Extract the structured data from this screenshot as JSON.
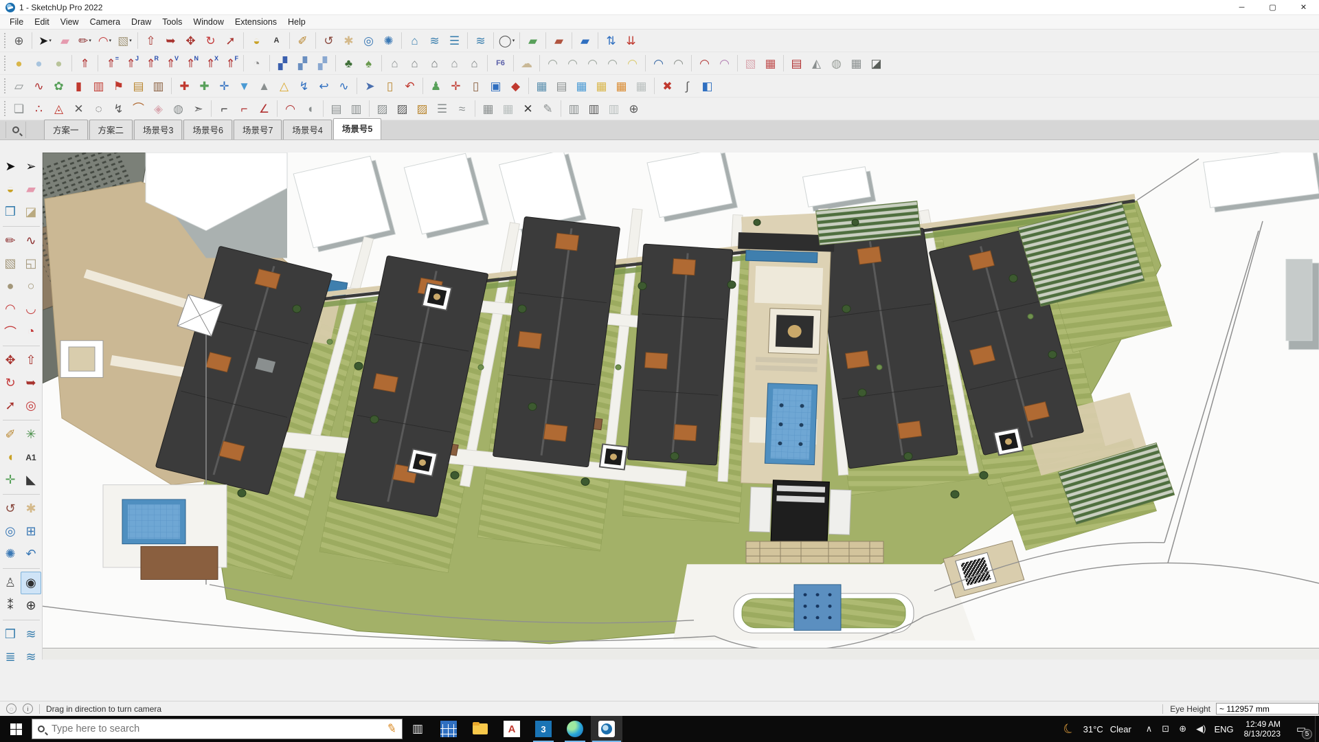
{
  "window": {
    "title": "1 - SketchUp Pro 2022",
    "minimize": "─",
    "maximize": "▢",
    "close": "✕"
  },
  "menu": {
    "items": [
      "File",
      "Edit",
      "View",
      "Camera",
      "Draw",
      "Tools",
      "Window",
      "Extensions",
      "Help"
    ]
  },
  "toolbars": {
    "rows": [
      [
        {
          "n": "zoom-tool",
          "g": "⊕",
          "c": "#5a5a5a"
        },
        {
          "sep": true
        },
        {
          "n": "select",
          "g": "➤",
          "c": "#1a1a1a",
          "dd": true
        },
        {
          "n": "eraser",
          "g": "▰",
          "c": "#e59aae"
        },
        {
          "n": "line",
          "g": "✏",
          "c": "#8c2f2f",
          "dd": true
        },
        {
          "n": "arc",
          "g": "◠",
          "c": "#c43b3b",
          "dd": true
        },
        {
          "n": "rectangle",
          "g": "▧",
          "c": "#a3977a",
          "dd": true
        },
        {
          "sep": true
        },
        {
          "n": "push-pull",
          "g": "⇧",
          "c": "#a8342f"
        },
        {
          "n": "follow-me",
          "g": "➥",
          "c": "#a8342f"
        },
        {
          "n": "move",
          "g": "✥",
          "c": "#a8342f"
        },
        {
          "n": "rotate",
          "g": "↻",
          "c": "#c43b3b"
        },
        {
          "n": "scale",
          "g": "➚",
          "c": "#a8342f"
        },
        {
          "sep": true
        },
        {
          "n": "paint-bucket",
          "g": "◒",
          "c": "#c9a227"
        },
        {
          "n": "text",
          "g": "A",
          "c": "#3a3a3a",
          "txt": true
        },
        {
          "sep": true
        },
        {
          "n": "tape-measure",
          "g": "✐",
          "c": "#b9862f"
        },
        {
          "sep": true
        },
        {
          "n": "orbit",
          "g": "↺",
          "c": "#8a4a3f"
        },
        {
          "n": "pan",
          "g": "✱",
          "c": "#d4b98a"
        },
        {
          "n": "zoom",
          "g": "◎",
          "c": "#3a78b5"
        },
        {
          "n": "zoom-extents",
          "g": "✺",
          "c": "#3a78b5"
        },
        {
          "sep": true
        },
        {
          "n": "section-plane",
          "g": "⌂",
          "c": "#3a7fae"
        },
        {
          "n": "section-display",
          "g": "≋",
          "c": "#3a7fae"
        },
        {
          "n": "section-fill",
          "g": "☰",
          "c": "#3a7fae"
        },
        {
          "sep": true
        },
        {
          "n": "section-cuts",
          "g": "≋",
          "c": "#3a7fae"
        },
        {
          "sep": true
        },
        {
          "n": "sign-in",
          "g": "◯",
          "c": "#5a5a5a",
          "dd": true
        },
        {
          "sep": true
        },
        {
          "n": "ext-terrain-green",
          "g": "▰",
          "c": "#58a05a"
        },
        {
          "sep": true
        },
        {
          "n": "ext-terrain-red",
          "g": "▰",
          "c": "#b0543f"
        },
        {
          "sep": true
        },
        {
          "n": "ext-slope-blue",
          "g": "▰",
          "c": "#2f6fc0"
        },
        {
          "sep": true
        },
        {
          "n": "ext-arrows-blue",
          "g": "⇅",
          "c": "#2f6fc0"
        },
        {
          "n": "ext-arrows-red",
          "g": "⇊",
          "c": "#c0392f"
        }
      ],
      [
        {
          "n": "style-gold",
          "g": "●",
          "c": "#d9b64a"
        },
        {
          "n": "style-blue",
          "g": "●",
          "c": "#a8c4de"
        },
        {
          "n": "style-green",
          "g": "●",
          "c": "#b9c49a"
        },
        {
          "sep": true
        },
        {
          "n": "lift-up",
          "g": "⇑",
          "c": "#b03030"
        },
        {
          "sep": true
        },
        {
          "n": "lift-equal",
          "g": "⇑",
          "c": "#b03030",
          "sup": "="
        },
        {
          "n": "lift-j",
          "g": "⇑",
          "c": "#b03030",
          "sup": "J"
        },
        {
          "n": "lift-r",
          "g": "⇑",
          "c": "#b03030",
          "sup": "R"
        },
        {
          "n": "lift-v",
          "g": "⇑",
          "c": "#b03030",
          "sup": "V"
        },
        {
          "n": "lift-n",
          "g": "⇑",
          "c": "#b03030",
          "sup": "N"
        },
        {
          "n": "lift-x",
          "g": "⇑",
          "c": "#b03030",
          "sup": "X"
        },
        {
          "n": "lift-f",
          "g": "⇑",
          "c": "#b03030",
          "sup": "F"
        },
        {
          "sep": true
        },
        {
          "n": "pie-tool",
          "g": "◔",
          "c": "#8a8a8a"
        },
        {
          "sep": true
        },
        {
          "n": "sketch-blue-1",
          "g": "▞",
          "c": "#3a5fae"
        },
        {
          "n": "sketch-blue-2",
          "g": "▞",
          "c": "#6a8fc0"
        },
        {
          "n": "sketch-blue-3",
          "g": "▞",
          "c": "#8aa8d0"
        },
        {
          "sep": true
        },
        {
          "n": "tree-dark",
          "g": "♣",
          "c": "#3f6f38"
        },
        {
          "n": "tree-light",
          "g": "♠",
          "c": "#6a9a4f"
        },
        {
          "sep": true
        },
        {
          "n": "house-1",
          "g": "⌂",
          "c": "#8a8f8f"
        },
        {
          "n": "house-2",
          "g": "⌂",
          "c": "#7a7f7f"
        },
        {
          "n": "house-3",
          "g": "⌂",
          "c": "#6a6f6f"
        },
        {
          "n": "house-4",
          "g": "⌂",
          "c": "#8a8f8f"
        },
        {
          "n": "house-5",
          "g": "⌂",
          "c": "#7a7f7f"
        },
        {
          "sep": true
        },
        {
          "n": "f6-tool",
          "g": "F6",
          "c": "#5a5fa8",
          "txt": true
        },
        {
          "sep": true
        },
        {
          "n": "cloud-tool",
          "g": "☁",
          "c": "#c9b896"
        },
        {
          "sep": true
        },
        {
          "n": "arc-edit-1",
          "g": "◠",
          "c": "#9aa39a"
        },
        {
          "n": "arc-edit-2",
          "g": "◠",
          "c": "#9aa39a"
        },
        {
          "n": "arc-edit-3",
          "g": "◠",
          "c": "#9aa39a"
        },
        {
          "n": "arc-edit-4",
          "g": "◠",
          "c": "#9aa39a"
        },
        {
          "n": "arc-edit-5",
          "g": "◠",
          "c": "#d9c96a"
        },
        {
          "sep": true
        },
        {
          "n": "curve-blue",
          "g": "◠",
          "c": "#2b5fa0"
        },
        {
          "n": "curve-gray",
          "g": "◠",
          "c": "#8a8f8a"
        },
        {
          "sep": true
        },
        {
          "n": "curve-red",
          "g": "◠",
          "c": "#b03030"
        },
        {
          "n": "curve-purple",
          "g": "◠",
          "c": "#b07ab0"
        },
        {
          "sep": true
        },
        {
          "n": "roof-pink",
          "g": "▧",
          "c": "#d9a8b0"
        },
        {
          "n": "roof-frame",
          "g": "▦",
          "c": "#c05050"
        },
        {
          "sep": true
        },
        {
          "n": "stairs-red",
          "g": "▤",
          "c": "#b03030"
        },
        {
          "n": "pyramid-gray",
          "g": "◭",
          "c": "#8a8f8f"
        },
        {
          "n": "dome-gray",
          "g": "◍",
          "c": "#9a9f9a"
        },
        {
          "n": "roof-grid",
          "g": "▦",
          "c": "#8a8f8f"
        },
        {
          "n": "roof-dark",
          "g": "◪",
          "c": "#5a5f5a"
        }
      ],
      [
        {
          "n": "note-pages",
          "g": "▱",
          "c": "#8a8f8f"
        },
        {
          "n": "path-dots",
          "g": "∿",
          "c": "#b03030"
        },
        {
          "n": "leaf-green",
          "g": "✿",
          "c": "#58a05a"
        },
        {
          "n": "panel-red",
          "g": "▮",
          "c": "#c0392f"
        },
        {
          "n": "window-red",
          "g": "▥",
          "c": "#c0392f"
        },
        {
          "n": "flag-red",
          "g": "⚑",
          "c": "#c0392f"
        },
        {
          "n": "crate-tan",
          "g": "▤",
          "c": "#b9862f"
        },
        {
          "n": "box-brown",
          "g": "▥",
          "c": "#8a5f3f"
        },
        {
          "sep": true
        },
        {
          "n": "pin-red",
          "g": "✚",
          "c": "#c0392f"
        },
        {
          "n": "grid-green-plus",
          "g": "✚",
          "c": "#58a05a"
        },
        {
          "n": "cross-blue",
          "g": "✛",
          "c": "#2f6fc0"
        },
        {
          "n": "drop-blue",
          "g": "▼",
          "c": "#4a9ad4"
        },
        {
          "n": "terrain-peak",
          "g": "▲",
          "c": "#8a8f8f"
        },
        {
          "n": "cone-warn",
          "g": "△",
          "c": "#d9a82f"
        },
        {
          "n": "spiral-blue",
          "g": "↯",
          "c": "#2f6fc0"
        },
        {
          "n": "hook-blue",
          "g": "↩",
          "c": "#2f6fc0"
        },
        {
          "n": "wave-blue",
          "g": "∿",
          "c": "#2f6fc0"
        },
        {
          "sep": true
        },
        {
          "n": "plane-jet",
          "g": "➤",
          "c": "#4a6fae"
        },
        {
          "n": "barrel-tan",
          "g": "▯",
          "c": "#b9862f"
        },
        {
          "n": "uturn-red",
          "g": "↶",
          "c": "#c0392f"
        },
        {
          "sep": true
        },
        {
          "n": "robot-green",
          "g": "♟",
          "c": "#58a05a"
        },
        {
          "n": "axis-gizmo",
          "g": "✛",
          "c": "#c0392f"
        },
        {
          "n": "door-tool",
          "g": "▯",
          "c": "#8a5f3f"
        },
        {
          "n": "window-tool",
          "g": "▣",
          "c": "#2f6fc0"
        },
        {
          "n": "gem-red",
          "g": "◆",
          "c": "#c0392f"
        },
        {
          "sep": true
        },
        {
          "n": "steel-grid",
          "g": "▦",
          "c": "#5a8fae"
        },
        {
          "n": "stairs-3d",
          "g": "▤",
          "c": "#8a8f8f"
        },
        {
          "n": "grid-blue",
          "g": "▦",
          "c": "#4a9ad4"
        },
        {
          "n": "grid-yellow",
          "g": "▦",
          "c": "#d9b64a"
        },
        {
          "n": "grid-orange",
          "g": "▦",
          "c": "#d98a2f"
        },
        {
          "n": "grid-white",
          "g": "▦",
          "c": "#b9bfbe"
        },
        {
          "sep": true
        },
        {
          "n": "close-red",
          "g": "✖",
          "c": "#c0392f"
        },
        {
          "n": "spline-tool",
          "g": "∫",
          "c": "#5a5a5a"
        },
        {
          "n": "cube-blue",
          "g": "◧",
          "c": "#2f6fc0"
        }
      ],
      [
        {
          "n": "surface-box",
          "g": "❏",
          "c": "#8a8f8f"
        },
        {
          "n": "polyline-dots",
          "g": "∴",
          "c": "#b03030"
        },
        {
          "n": "triangulate",
          "g": "◬",
          "c": "#c0392f"
        },
        {
          "n": "vertex-edit",
          "g": "✕",
          "c": "#5a5a5a"
        },
        {
          "n": "dashed-loop",
          "g": "◌",
          "c": "#5a5a5a"
        },
        {
          "n": "mesh-flip",
          "g": "↯",
          "c": "#5a5a5a"
        },
        {
          "n": "pipe-curve",
          "g": "⌒",
          "c": "#b06a33"
        },
        {
          "n": "fold-box",
          "g": "◈",
          "c": "#d9a8b0"
        },
        {
          "n": "orb-gray",
          "g": "◍",
          "c": "#8a8f8f"
        },
        {
          "n": "arrow-path",
          "g": "➣",
          "c": "#5a5a5a"
        },
        {
          "sep": true
        },
        {
          "n": "corner-dark",
          "g": "⌐",
          "c": "#3a3a3a"
        },
        {
          "n": "corner-red",
          "g": "⌐",
          "c": "#b03030"
        },
        {
          "n": "angle-red",
          "g": "∠",
          "c": "#b03030"
        },
        {
          "sep": true
        },
        {
          "n": "arc-wide",
          "g": "◠",
          "c": "#b03030"
        },
        {
          "n": "shell-tool",
          "g": "◖",
          "c": "#8a8f8f"
        },
        {
          "sep": true
        },
        {
          "n": "ruler-stack",
          "g": "▤",
          "c": "#8a8f8f"
        },
        {
          "n": "column-chart",
          "g": "▥",
          "c": "#8a8f8f"
        },
        {
          "sep": true
        },
        {
          "n": "hatch-1",
          "g": "▨",
          "c": "#8a8f8f"
        },
        {
          "n": "hatch-2",
          "g": "▨",
          "c": "#5a5a5a"
        },
        {
          "n": "hatch-3",
          "g": "▨",
          "c": "#b9862f"
        },
        {
          "n": "comb-tool",
          "g": "☰",
          "c": "#8a8f8f"
        },
        {
          "n": "waves-tool",
          "g": "≈",
          "c": "#8a8f8f"
        },
        {
          "sep": true
        },
        {
          "n": "mesh-dense",
          "g": "▦",
          "c": "#8a8f8f"
        },
        {
          "n": "mesh-light",
          "g": "▦",
          "c": "#b9bfbe"
        },
        {
          "n": "x-dark",
          "g": "✕",
          "c": "#3a3a3a"
        },
        {
          "n": "pencil-flat",
          "g": "✎",
          "c": "#8a8f8f"
        },
        {
          "sep": true
        },
        {
          "n": "fence-1",
          "g": "▥",
          "c": "#8a8f8f"
        },
        {
          "n": "fence-2",
          "g": "▥",
          "c": "#5a5a5a"
        },
        {
          "n": "fence-3",
          "g": "▥",
          "c": "#b9bfbe"
        },
        {
          "n": "compass-gray",
          "g": "⊕",
          "c": "#5a5a5a"
        }
      ]
    ]
  },
  "scene_tabs": {
    "active": "场景号5",
    "tabs": [
      "方案一",
      "方案二",
      "场景号3",
      "场景号6",
      "场景号7",
      "场景号4",
      "场景号5"
    ]
  },
  "left_palette": {
    "active": "look-around",
    "items": [
      {
        "n": "select",
        "g": "➤",
        "c": "#111111"
      },
      {
        "n": "lasso-select",
        "g": "➢",
        "c": "#111111"
      },
      {
        "n": "paint-bucket",
        "g": "◒",
        "c": "#c9a227"
      },
      {
        "n": "eraser",
        "g": "▰",
        "c": "#e59aae"
      },
      {
        "n": "component",
        "g": "❒",
        "c": "#3a7fae"
      },
      {
        "n": "tag",
        "g": "◪",
        "c": "#b9a97f"
      },
      {
        "div": true
      },
      {
        "n": "line",
        "g": "✏",
        "c": "#8c2f2f"
      },
      {
        "n": "freehand",
        "g": "∿",
        "c": "#8c2f2f"
      },
      {
        "n": "rectangle",
        "g": "▧",
        "c": "#a3977a"
      },
      {
        "n": "rotated-rectangle",
        "g": "◱",
        "c": "#a3977a"
      },
      {
        "n": "circle",
        "g": "●",
        "c": "#a3977a"
      },
      {
        "n": "polygon",
        "g": "○",
        "c": "#a3977a"
      },
      {
        "n": "arc",
        "g": "◠",
        "c": "#c43b3b"
      },
      {
        "n": "two-point-arc",
        "g": "◡",
        "c": "#c43b3b"
      },
      {
        "n": "three-point-arc",
        "g": "⌒",
        "c": "#c43b3b"
      },
      {
        "n": "pie",
        "g": "◔",
        "c": "#c43b3b"
      },
      {
        "div": true
      },
      {
        "n": "move",
        "g": "✥",
        "c": "#a8342f"
      },
      {
        "n": "push-pull",
        "g": "⇧",
        "c": "#a8342f"
      },
      {
        "n": "rotate",
        "g": "↻",
        "c": "#c43b3b"
      },
      {
        "n": "follow-me",
        "g": "➥",
        "c": "#a8342f"
      },
      {
        "n": "scale",
        "g": "➚",
        "c": "#a8342f"
      },
      {
        "n": "offset",
        "g": "◎",
        "c": "#c43b3b"
      },
      {
        "div": true
      },
      {
        "n": "tape-measure",
        "g": "✐",
        "c": "#b9862f"
      },
      {
        "n": "axes",
        "g": "✳",
        "c": "#4a8f4a"
      },
      {
        "n": "protractor",
        "g": "◖",
        "c": "#c9a227"
      },
      {
        "n": "text",
        "g": "A1",
        "c": "#3a3a3a",
        "txt": true
      },
      {
        "n": "move-axes",
        "g": "✛",
        "c": "#58a05a"
      },
      {
        "n": "3d-text",
        "g": "◣",
        "c": "#3a3a3a"
      },
      {
        "div": true
      },
      {
        "n": "orbit",
        "g": "↺",
        "c": "#8a4a3f"
      },
      {
        "n": "pan",
        "g": "✱",
        "c": "#d4b98a"
      },
      {
        "n": "zoom",
        "g": "◎",
        "c": "#3a78b5"
      },
      {
        "n": "zoom-window",
        "g": "⊞",
        "c": "#3a78b5"
      },
      {
        "n": "zoom-extents",
        "g": "✺",
        "c": "#3a78b5"
      },
      {
        "n": "zoom-previous",
        "g": "↶",
        "c": "#3a78b5"
      },
      {
        "div": true
      },
      {
        "n": "position-camera",
        "g": "♙",
        "c": "#5a5a5a"
      },
      {
        "n": "look-around",
        "g": "◉",
        "c": "#2f2f2f"
      },
      {
        "n": "walk",
        "g": "⁑",
        "c": "#2f2f2f"
      },
      {
        "n": "navigation-compass",
        "g": "⊕",
        "c": "#2f2f2f"
      },
      {
        "div": true
      },
      {
        "n": "section-box",
        "g": "❒",
        "c": "#3a7fae"
      },
      {
        "n": "section-flip",
        "g": "≋",
        "c": "#3a7fae"
      },
      {
        "n": "layers-blue",
        "g": "≣",
        "c": "#3a7fae"
      },
      {
        "n": "section-settings",
        "g": "≋",
        "c": "#3a7fae"
      }
    ]
  },
  "viewport": {
    "palette": {
      "roof_dark": "#3c3c3c",
      "lawn_green": "#a3b168",
      "pool_blue": "#4f8fc0",
      "paving_tan": "#cbb894",
      "context_gray": "#a7aeae",
      "roof_accent_orange": "#b06a33"
    }
  },
  "status_bar": {
    "hint": "Drag in direction to turn camera",
    "eye_height_label": "Eye Height",
    "eye_height_value": "~ 112957 mm",
    "info_glyph": "i"
  },
  "taskbar": {
    "search": {
      "placeholder": "Type here to search"
    },
    "apps": [
      {
        "n": "grid-app",
        "k": "grid"
      },
      {
        "n": "file-explorer",
        "k": "folder"
      },
      {
        "n": "autocad",
        "k": "acad",
        "label": "A"
      },
      {
        "n": "3ds-max",
        "k": "max",
        "label": "3",
        "running": true
      },
      {
        "n": "edge",
        "k": "edge",
        "running": true
      },
      {
        "n": "sketchup",
        "k": "sketchup",
        "active": true
      }
    ],
    "weather": {
      "temp": "31°C",
      "desc": "Clear"
    },
    "language": "ENG",
    "clock": {
      "time": "12:49 AM",
      "date": "8/13/2023"
    },
    "notifications": {
      "count": "5"
    }
  }
}
